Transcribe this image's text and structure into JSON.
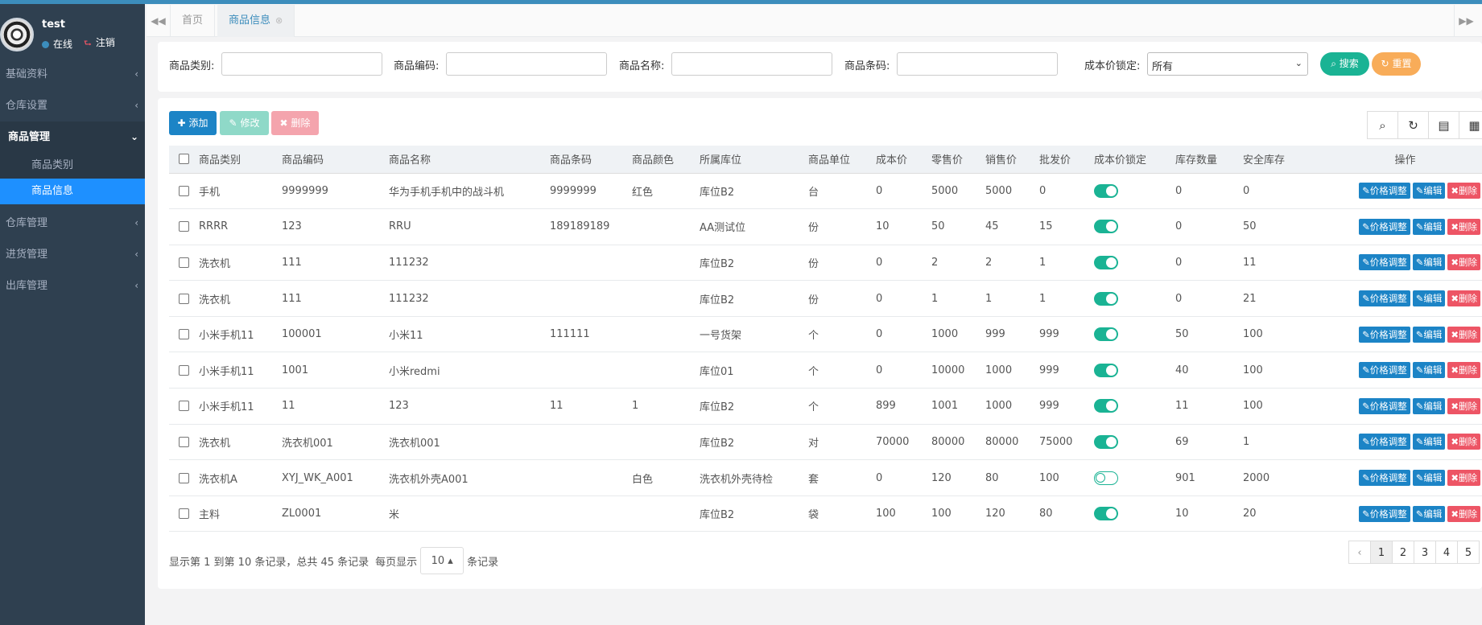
{
  "user": {
    "name": "test",
    "status": "在线",
    "logout": "注销"
  },
  "sidebar": {
    "items": [
      {
        "label": "基础资料",
        "arrow": "‹"
      },
      {
        "label": "仓库设置",
        "arrow": "‹"
      },
      {
        "label": "商品管理",
        "arrow": "⌄"
      },
      {
        "label": "仓库管理",
        "arrow": "‹"
      },
      {
        "label": "进货管理",
        "arrow": "‹"
      },
      {
        "label": "出库管理",
        "arrow": "‹"
      }
    ],
    "sub_items": [
      {
        "label": "商品类别"
      },
      {
        "label": "商品信息"
      }
    ]
  },
  "tabs": [
    {
      "label": "首页"
    },
    {
      "label": "商品信息"
    }
  ],
  "search": {
    "category_label": "商品类别:",
    "code_label": "商品编码:",
    "name_label": "商品名称:",
    "barcode_label": "商品条码:",
    "lock_label": "成本价锁定:",
    "lock_value": "所有",
    "search_btn": "搜索",
    "reset_btn": "重置"
  },
  "toolbar": {
    "add": "添加",
    "edit": "修改",
    "delete": "删除"
  },
  "table": {
    "columns": [
      "商品类别",
      "商品编码",
      "商品名称",
      "商品条码",
      "商品颜色",
      "所属库位",
      "商品单位",
      "成本价",
      "零售价",
      "销售价",
      "批发价",
      "成本价锁定",
      "库存数量",
      "安全库存",
      "操作"
    ],
    "actions": {
      "price": "价格调整",
      "edit": "编辑",
      "delete": "删除"
    },
    "rows": [
      {
        "category": "手机",
        "code": "9999999",
        "name": "华为手机手机中的战斗机",
        "barcode": "9999999",
        "color": "红色",
        "location": "库位B2",
        "unit": "台",
        "cost": "0",
        "retail": "5000",
        "sale": "5000",
        "wholesale": "0",
        "locked": true,
        "stock": "0",
        "safe": "0"
      },
      {
        "category": "RRRR",
        "code": "123",
        "name": "RRU",
        "barcode": "189189189",
        "color": "",
        "location": "AA测试位",
        "unit": "份",
        "cost": "10",
        "retail": "50",
        "sale": "45",
        "wholesale": "15",
        "locked": true,
        "stock": "0",
        "safe": "50"
      },
      {
        "category": "洗衣机",
        "code": "111",
        "name": "111232",
        "barcode": "",
        "color": "",
        "location": "库位B2",
        "unit": "份",
        "cost": "0",
        "retail": "2",
        "sale": "2",
        "wholesale": "1",
        "locked": true,
        "stock": "0",
        "safe": "11"
      },
      {
        "category": "洗衣机",
        "code": "111",
        "name": "111232",
        "barcode": "",
        "color": "",
        "location": "库位B2",
        "unit": "份",
        "cost": "0",
        "retail": "1",
        "sale": "1",
        "wholesale": "1",
        "locked": true,
        "stock": "0",
        "safe": "21"
      },
      {
        "category": "小米手机11",
        "code": "100001",
        "name": "小米11",
        "barcode": "111111",
        "color": "",
        "location": "一号货架",
        "unit": "个",
        "cost": "0",
        "retail": "1000",
        "sale": "999",
        "wholesale": "999",
        "locked": true,
        "stock": "50",
        "safe": "100"
      },
      {
        "category": "小米手机11",
        "code": "1001",
        "name": "小米redmi",
        "barcode": "",
        "color": "",
        "location": "库位01",
        "unit": "个",
        "cost": "0",
        "retail": "10000",
        "sale": "1000",
        "wholesale": "999",
        "locked": true,
        "stock": "40",
        "safe": "100"
      },
      {
        "category": "小米手机11",
        "code": "11",
        "name": "123",
        "barcode": "11",
        "color": "1",
        "location": "库位B2",
        "unit": "个",
        "cost": "899",
        "retail": "1001",
        "sale": "1000",
        "wholesale": "999",
        "locked": true,
        "stock": "11",
        "safe": "100"
      },
      {
        "category": "洗衣机",
        "code": "洗衣机001",
        "name": "洗衣机001",
        "barcode": "",
        "color": "",
        "location": "库位B2",
        "unit": "对",
        "cost": "70000",
        "retail": "80000",
        "sale": "80000",
        "wholesale": "75000",
        "locked": true,
        "stock": "69",
        "safe": "1"
      },
      {
        "category": "洗衣机A",
        "code": "XYJ_WK_A001",
        "name": "洗衣机外壳A001",
        "barcode": "",
        "color": "白色",
        "location": "洗衣机外壳待检",
        "unit": "套",
        "cost": "0",
        "retail": "120",
        "sale": "80",
        "wholesale": "100",
        "locked": false,
        "stock": "901",
        "safe": "2000"
      },
      {
        "category": "主料",
        "code": "ZL0001",
        "name": "米",
        "barcode": "",
        "color": "",
        "location": "库位B2",
        "unit": "袋",
        "cost": "100",
        "retail": "100",
        "sale": "120",
        "wholesale": "80",
        "locked": true,
        "stock": "10",
        "safe": "20"
      }
    ]
  },
  "pagination": {
    "info": "显示第 1 到第 10 条记录，总共 45 条记录",
    "per_page_prefix": "每页显示",
    "per_page": "10 ▴",
    "per_page_suffix": "条记录",
    "prev": "‹",
    "pages": [
      "1",
      "2",
      "3",
      "4",
      "5"
    ]
  }
}
